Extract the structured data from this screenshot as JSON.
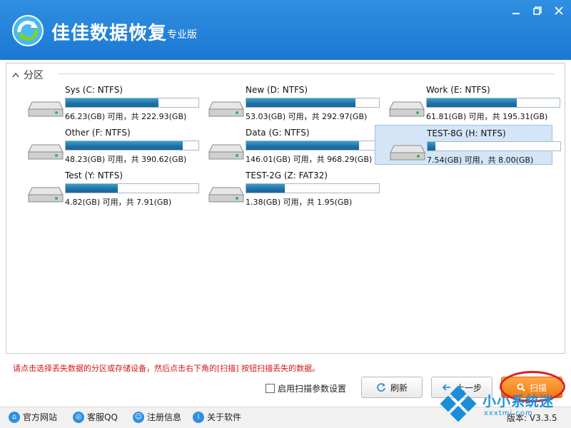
{
  "app": {
    "title": "佳佳数据恢复",
    "edition": "专业版"
  },
  "window_controls": [
    "minimize",
    "restore",
    "close"
  ],
  "section": {
    "label": "分区"
  },
  "drives": [
    {
      "name": "Sys (C: NTFS)",
      "info": "66.23(GB) 可用，共 222.93(GB)",
      "used_fraction": 0.7,
      "selected": false
    },
    {
      "name": "New (D: NTFS)",
      "info": "53.03(GB) 可用，共 292.97(GB)",
      "used_fraction": 0.82,
      "selected": false
    },
    {
      "name": "Work (E: NTFS)",
      "info": "61.81(GB) 可用，共 195.31(GB)",
      "used_fraction": 0.68,
      "selected": false
    },
    {
      "name": "Other (F: NTFS)",
      "info": "48.23(GB) 可用，共 390.62(GB)",
      "used_fraction": 0.88,
      "selected": false
    },
    {
      "name": "Data (G: NTFS)",
      "info": "146.01(GB) 可用，共 968.29(GB)",
      "used_fraction": 0.85,
      "selected": false
    },
    {
      "name": "TEST-8G (H: NTFS)",
      "info": "7.54(GB) 可用，共 8.00(GB)",
      "used_fraction": 0.06,
      "selected": true
    },
    {
      "name": "Test (Y: NTFS)",
      "info": "4.82(GB) 可用，共 7.91(GB)",
      "used_fraction": 0.39,
      "selected": false
    },
    {
      "name": "TEST-2G (Z: FAT32)",
      "info": "1.38(GB) 可用，共 1.95(GB)",
      "used_fraction": 0.29,
      "selected": false
    }
  ],
  "hint": "请点击选择丢失数据的分区或存储设备，然后点击右下角的[扫描] 按钮扫描丢失的数据。",
  "options": {
    "scan_params_label": "启用扫描参数设置"
  },
  "buttons": {
    "refresh": "刷新",
    "prev": "上一步",
    "scan": "扫描"
  },
  "footer": {
    "links": [
      "官方网站",
      "客服QQ",
      "注册信息",
      "关于软件"
    ],
    "version": "版本: V3.3.5"
  },
  "watermark": {
    "text": "小小系统迷",
    "sub": "xxxtmi.com"
  },
  "colors": {
    "titlebar": "#1b78d2",
    "hint": "#d41717",
    "scan_button": "#f47a10",
    "selected_drive": "#d4e5f8"
  }
}
